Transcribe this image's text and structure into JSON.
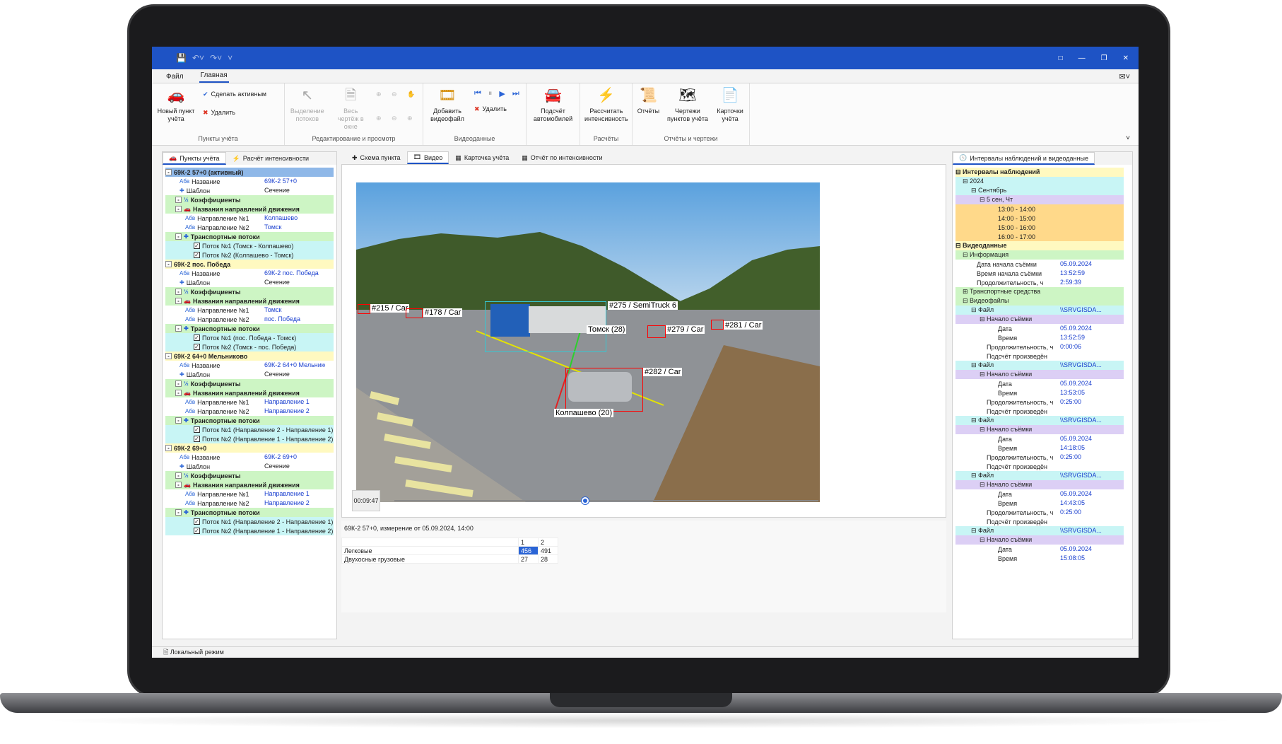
{
  "menu": {
    "file": "Файл",
    "home": "Главная"
  },
  "ribbon": {
    "new_point": "Новый пункт учёта",
    "make_active": "Сделать активным",
    "delete": "Удалить",
    "group_points": "Пункты учёта",
    "select_flows": "Выделение потоков",
    "whole_drawing": "Весь чертёж в окне",
    "group_edit": "Редактирование и просмотр",
    "add_video": "Добавить видеофайл",
    "delete_video": "Удалить",
    "group_video": "Видеоданные",
    "count_cars": "Подсчёт автомобилей",
    "calc_intensity": "Рассчитать интенсивность",
    "group_calc": "Расчёты",
    "reports": "Отчёты",
    "drawings": "Чертежи пунктов учёта",
    "cards": "Карточки учёта",
    "group_reports": "Отчёты и чертежи"
  },
  "left_panel": {
    "tab1": "Пункты учёта",
    "tab2": "Расчёт интенсивности",
    "points": [
      {
        "title": "69К-2 57+0 (активный)",
        "name_label": "Название",
        "name": "69К-2 57+0",
        "template_label": "Шаблон",
        "template": "Сечение",
        "coef": "Коэффициенты",
        "dirs": "Названия направлений движения",
        "dir1_label": "Направление №1",
        "dir1": "Колпашево",
        "dir2_label": "Направление №2",
        "dir2": "Томск",
        "flows": "Транспортные потоки",
        "flow1": "Поток №1 (Томск - Колпашево)",
        "flow2": "Поток №2 (Колпашево - Томск)"
      },
      {
        "title": "69К-2 пос. Победа",
        "name_label": "Название",
        "name": "69К-2 пос. Победа",
        "template_label": "Шаблон",
        "template": "Сечение",
        "coef": "Коэффициенты",
        "dirs": "Названия направлений движения",
        "dir1_label": "Направление №1",
        "dir1": "Томск",
        "dir2_label": "Направление №2",
        "dir2": "пос. Победа",
        "flows": "Транспортные потоки",
        "flow1": "Поток №1 (пос. Победа - Томск)",
        "flow2": "Поток №2 (Томск - пос. Победа)"
      },
      {
        "title": "69К-2 64+0 Мельниково",
        "name_label": "Название",
        "name": "69К-2 64+0 Мельниково",
        "template_label": "Шаблон",
        "template": "Сечение",
        "coef": "Коэффициенты",
        "dirs": "Названия направлений движения",
        "dir1_label": "Направление №1",
        "dir1": "Направление 1",
        "dir2_label": "Направление №2",
        "dir2": "Направление 2",
        "flows": "Транспортные потоки",
        "flow1": "Поток №1 (Направление 2 - Направление 1)",
        "flow2": "Поток №2 (Направление 1 - Направление 2)"
      },
      {
        "title": "69К-2 69+0",
        "name_label": "Название",
        "name": "69К-2 69+0",
        "template_label": "Шаблон",
        "template": "Сечение",
        "coef": "Коэффициенты",
        "dirs": "Названия направлений движения",
        "dir1_label": "Направление №1",
        "dir1": "Направление 1",
        "dir2_label": "Направление №2",
        "dir2": "Направление 2",
        "flows": "Транспортные потоки",
        "flow1": "Поток №1 (Направление 2 - Направление 1)",
        "flow2": "Поток №2 (Направление 1 - Направление 2)"
      }
    ]
  },
  "center": {
    "tab_scheme": "Схема пункта",
    "tab_video": "Видео",
    "tab_card": "Карточка учёта",
    "tab_report": "Отчёт по интенсивности",
    "timecode": "00:09:47",
    "progress": 0.45,
    "labels": {
      "l215": "#215 / Car",
      "l178": "#178 / Car",
      "l275": "#275 / SemiTruck 6",
      "l279": "#279 / Car",
      "l281": "#281 / Car",
      "l282": "#282 / Car",
      "tomsk": "Томск (28)",
      "kolp": "Колпашево (20)"
    },
    "measurement_title": "69К-2 57+0, измерение от 05.09.2024, 14:00",
    "table": {
      "headers": [
        "1",
        "2"
      ],
      "rows": [
        {
          "name": "Легковые",
          "v1": "456",
          "v2": "491"
        },
        {
          "name": "Двухосные грузовые",
          "v1": "27",
          "v2": "28"
        }
      ]
    }
  },
  "right_panel": {
    "tab": "Интервалы наблюдений и видеоданные",
    "intervals": "Интервалы наблюдений",
    "year": "2024",
    "month": "Сентябрь",
    "day": "5 сен, Чт",
    "slots": [
      "13:00 - 14:00",
      "14:00 - 15:00",
      "15:00 - 16:00",
      "16:00 - 17:00"
    ],
    "videodata": "Видеоданные",
    "info": "Информация",
    "info_rows": [
      {
        "k": "Дата начала съёмки",
        "v": "05.09.2024"
      },
      {
        "k": "Время начала съёмки",
        "v": "13:52:59"
      },
      {
        "k": "Продолжительность, ч",
        "v": "2:59:39"
      }
    ],
    "transport": "Транспортные средства",
    "videofiles": "Видеофайлы",
    "file_label": "Файл",
    "start_label": "Начало съёмки",
    "date_label": "Дата",
    "time_label": "Время",
    "dur_label": "Продолжительность, ч",
    "count_label": "Подсчёт произведён",
    "files": [
      {
        "path": "\\\\SRVGISDA...",
        "date": "05.09.2024",
        "time": "13:52:59",
        "dur": "0:00:06"
      },
      {
        "path": "\\\\SRVGISDA...",
        "date": "05.09.2024",
        "time": "13:53:05",
        "dur": "0:25:00"
      },
      {
        "path": "\\\\SRVGISDA...",
        "date": "05.09.2024",
        "time": "14:18:05",
        "dur": "0:25:00"
      },
      {
        "path": "\\\\SRVGISDA...",
        "date": "05.09.2024",
        "time": "14:43:05",
        "dur": "0:25:00"
      },
      {
        "path": "\\\\SRVGISDA...",
        "date": "05.09.2024",
        "time": "15:08:05",
        "dur": ""
      }
    ]
  },
  "status": "Локальный режим"
}
